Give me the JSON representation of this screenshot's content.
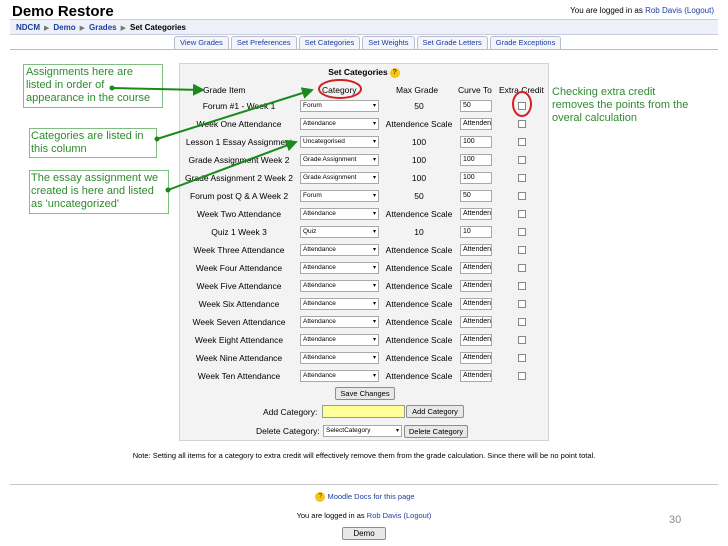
{
  "header": {
    "title": "Demo Restore",
    "login_prefix": "You are logged in as",
    "user": "Rob Davis",
    "logout": "(Logout)"
  },
  "breadcrumb": [
    "NDCM",
    "Demo",
    "Grades",
    "Set Categories"
  ],
  "tabs": [
    "View Grades",
    "Set Preferences",
    "Set Categories",
    "Set Weights",
    "Set Grade Letters",
    "Grade Exceptions"
  ],
  "panel": {
    "title": "Set Categories",
    "headers": {
      "item": "Grade Item",
      "category": "Category",
      "max": "Max Grade",
      "curve": "Curve To",
      "extra": "Extra Credit"
    },
    "rows": [
      {
        "item": "Forum #1 - Week 1",
        "category": "Forum",
        "max": "50",
        "curve": "50"
      },
      {
        "item": "Week One Attendance",
        "category": "Attendance",
        "max": "Attendence Scale",
        "curve": "Attenden"
      },
      {
        "item": "Lesson 1 Essay Assignment",
        "category": "Uncategorised",
        "max": "100",
        "curve": "100"
      },
      {
        "item": "Grade Assignment Week 2",
        "category": "Grade Assignment",
        "max": "100",
        "curve": "100"
      },
      {
        "item": "Grade Assignment 2 Week 2",
        "category": "Grade Assignment",
        "max": "100",
        "curve": "100"
      },
      {
        "item": "Forum post Q & A Week 2",
        "category": "Forum",
        "max": "50",
        "curve": "50"
      },
      {
        "item": "Week Two Attendance",
        "category": "Attendance",
        "max": "Attendence Scale",
        "curve": "Attenden"
      },
      {
        "item": "Quiz 1 Week 3",
        "category": "Quiz",
        "max": "10",
        "curve": "10"
      },
      {
        "item": "Week Three Attendance",
        "category": "Attendance",
        "max": "Attendence Scale",
        "curve": "Attenden"
      },
      {
        "item": "Week Four Attendance",
        "category": "Attendance",
        "max": "Attendence Scale",
        "curve": "Attenden"
      },
      {
        "item": "Week Five Attendance",
        "category": "Attendance",
        "max": "Attendence Scale",
        "curve": "Attenden"
      },
      {
        "item": "Week Six Attendance",
        "category": "Attendance",
        "max": "Attendence Scale",
        "curve": "Attenden"
      },
      {
        "item": "Week Seven Attendance",
        "category": "Attendance",
        "max": "Attendence Scale",
        "curve": "Attenden"
      },
      {
        "item": "Week Eight Attendance",
        "category": "Attendance",
        "max": "Attendence Scale",
        "curve": "Attenden"
      },
      {
        "item": "Week Nine Attendance",
        "category": "Attendance",
        "max": "Attendence Scale",
        "curve": "Attenden"
      },
      {
        "item": "Week Ten Attendance",
        "category": "Attendance",
        "max": "Attendence Scale",
        "curve": "Attenden"
      }
    ],
    "save_button": "Save Changes",
    "add_category_label": "Add Category:",
    "add_category_button": "Add Category",
    "delete_category_label": "Delete Category:",
    "delete_select": "SelectCategory",
    "delete_button": "Delete Category"
  },
  "note": "Note: Setting all items for a category to extra credit will effectively remove them from the grade calculation. Since there will be no point total.",
  "footer": {
    "docs": "Moodle Docs for this page",
    "login_prefix": "You are logged in as",
    "user": "Rob Davis",
    "logout": "(Logout)",
    "course_button": "Demo"
  },
  "annotations": {
    "a1": [
      "Assignments here are",
      "listed in order of",
      "appearance in the course"
    ],
    "a2": [
      "Categories are listed in",
      "this column"
    ],
    "a3": [
      "The essay assignment we",
      "created is here and listed",
      "as 'uncategorized'"
    ],
    "a4": [
      "Checking extra credit",
      "removes the points from the",
      "overal calculation"
    ]
  },
  "slide_number": "30",
  "colors": {
    "annotation": "#2e8b2e",
    "highlight_circle": "#d42020",
    "link": "#1a3ea0"
  }
}
